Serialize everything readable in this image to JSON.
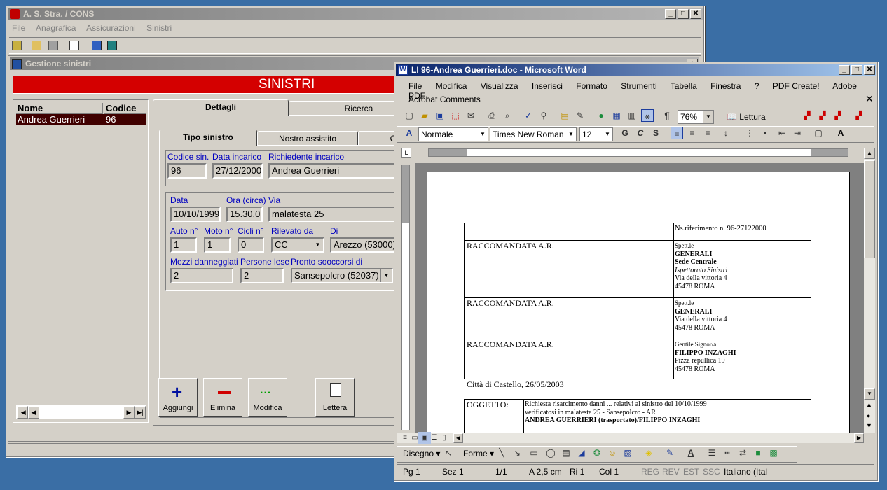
{
  "desktop": {
    "background": "#3a6ea5"
  },
  "app": {
    "title": "A. S. Stra. / CONS",
    "menu": [
      "File",
      "Anagrafica",
      "Assicurazioni",
      "Sinistri"
    ],
    "child_title": "Gestione sinistri",
    "banner": "SINISTRI",
    "banner_color": "#d40000",
    "list": {
      "headers": [
        "Nome",
        "Codice"
      ],
      "rows": [
        {
          "nome": "Andrea Guerrieri",
          "codice": "96"
        }
      ]
    },
    "tabs": [
      "Dettagli",
      "Ricerca"
    ],
    "subtabs": [
      "Tipo sinistro",
      "Nostro assistito",
      "C"
    ],
    "fields": {
      "codice_sin_label": "Codice sin.",
      "codice_sin": "96",
      "data_incarico_label": "Data incarico",
      "data_incarico": "27/12/2000",
      "richiedente_label": "Richiedente incarico",
      "richiedente": "Andrea Guerrieri",
      "data_label": "Data",
      "data": "10/10/1999",
      "ora_label": "Ora (circa)",
      "ora": "15.30.0",
      "via_label": "Via",
      "via": "malatesta 25",
      "auto_label": "Auto n°",
      "auto": "1",
      "moto_label": "Moto n°",
      "moto": "1",
      "cicli_label": "Cicli n°",
      "cicli": "0",
      "rilevato_label": "Rilevato da",
      "rilevato": "CC",
      "di_label": "Di",
      "di": "Arezzo (53000)",
      "mezzi_label": "Mezzi danneggiati",
      "mezzi": "2",
      "persone_label": "Persone lese",
      "persone": "2",
      "pronto_label": "Pronto sooccorsi di",
      "pronto": "Sansepolcro (52037)"
    },
    "buttons": {
      "aggiungi": "Aggiungi",
      "elimina": "Elimina",
      "modifica": "Modifica",
      "lettera": "Lettera"
    }
  },
  "word": {
    "title": "LI 96-Andrea Guerrieri.doc - Microsoft Word",
    "menu": [
      "File",
      "Modifica",
      "Visualizza",
      "Inserisci",
      "Formato",
      "Strumenti",
      "Tabella",
      "Finestra",
      "?",
      "PDF Create!",
      "Adobe PDF"
    ],
    "menu2": "Acrobat Comments",
    "zoom": "76%",
    "lettura": "Lettura",
    "style": "Normale",
    "font": "Times New Roman",
    "size": "12",
    "bold": "G",
    "italic": "C",
    "underline": "S",
    "doc": {
      "ref": "Ns.riferimento n. 96-27122000",
      "raccomandata": "RACCOMANDATA A.R.",
      "addr1": [
        "Spett.le",
        "GENERALI",
        "Sede Centrale",
        "Ispettorato Sinistri",
        "Via della vittoria 4",
        "45478 ROMA"
      ],
      "addr2": [
        "Spett.le",
        "GENERALI",
        "Via della vittoria 4",
        "45478 ROMA"
      ],
      "addr3": [
        "Gentile Signor/a",
        "FILIPPO INZAGHI",
        "Pizza repullica 19",
        "45478 ROMA"
      ],
      "city_date": "Città di Castello, 26/05/2003",
      "oggetto_label": "OGGETTO:",
      "oggetto": [
        "Richiesta risarcimento danni ... relativi al sinistro del 10/10/1999",
        "verificatosi in malatesta 25 - Sansepolcro - AR",
        "ANDREA GUERRIERI (trasportato)/FILIPPO INZAGHI"
      ]
    },
    "drawing": {
      "disegno": "Disegno",
      "forme": "Forme"
    },
    "status": {
      "pg": "Pg 1",
      "sez": "Sez 1",
      "pages": "1/1",
      "a": "A 2,5 cm",
      "ri": "Ri 1",
      "col": "Col 1",
      "reg": "REG",
      "rev": "REV",
      "est": "EST",
      "ssc": "SSC",
      "lang": "Italiano (Ital"
    }
  }
}
